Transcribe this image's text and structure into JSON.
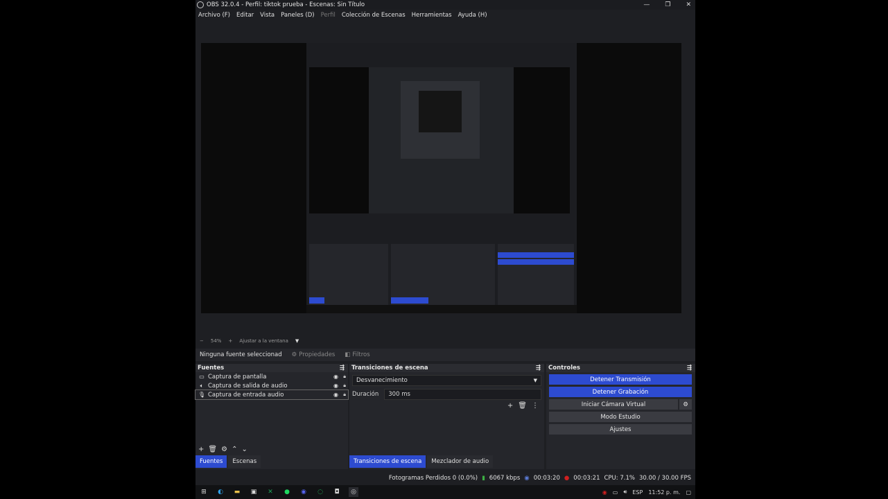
{
  "window": {
    "title": "OBS 32.0.4 - Perfil: tiktok prueba - Escenas: Sin Título",
    "controls": [
      "—",
      "❐",
      "✕"
    ]
  },
  "menu": {
    "items": [
      "Archivo (F)",
      "Editar",
      "Vista",
      "Paneles (D)",
      "Perfil",
      "Colección de Escenas",
      "Herramientas",
      "Ayuda (H)"
    ]
  },
  "zoom": {
    "minus": "−",
    "value": "54%",
    "plus": "+",
    "fit": "Ajustar a la ventana"
  },
  "source_toolbar": {
    "no_selection": "Ninguna fuente seleccionad",
    "properties": "Propiedades",
    "filters": "Filtros"
  },
  "sources": {
    "header": "Fuentes",
    "items": [
      {
        "label": "Captura de pantalla",
        "icon": "monitor-icon"
      },
      {
        "label": "Captura de salida de audio",
        "icon": "speaker-icon"
      },
      {
        "label": "Captura de entrada audio",
        "icon": "microphone-icon"
      }
    ]
  },
  "transitions": {
    "header": "Transiciones de escena",
    "selected": "Desvanecimiento",
    "duration_label": "Duración",
    "duration_value": "300 ms"
  },
  "controls": {
    "header": "Controles",
    "stop_stream": "Detener Transmisión",
    "stop_record": "Detener Grabación",
    "virtual_cam": "Iniciar Cámara Virtual",
    "studio_mode": "Modo Estudio",
    "settings": "Ajustes"
  },
  "tabs": {
    "left": [
      "Fuentes",
      "Escenas"
    ],
    "middle": [
      "Transiciones de escena",
      "Mezclador de audio"
    ]
  },
  "status": {
    "dropped_frames": "Fotogramas Perdidos 0 (0.0%)",
    "bitrate": "6067 kbps",
    "stream_time": "00:03:20",
    "record_time": "00:03:21",
    "cpu": "CPU: 7.1%",
    "fps": "30.00 / 30.00 FPS"
  },
  "taskbar": {
    "lang": "ESP",
    "time": "11:52 p. m."
  },
  "colors": {
    "accent": "#2d4bd0",
    "record": "#d02020"
  }
}
